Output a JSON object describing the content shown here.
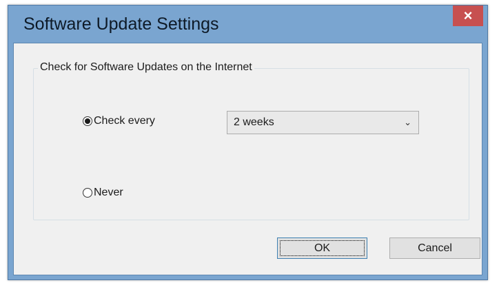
{
  "window": {
    "title": "Software Update Settings",
    "close_symbol": "×"
  },
  "group": {
    "legend": "Check for Software Updates on the Internet"
  },
  "options": {
    "check_every": {
      "label": "Check every",
      "selected": true
    },
    "never": {
      "label": "Never",
      "selected": false
    }
  },
  "frequency": {
    "value": "2 weeks",
    "chevron": "⌄"
  },
  "buttons": {
    "ok": "OK",
    "cancel": "Cancel"
  },
  "colors": {
    "frame": "#7aa5d0",
    "close": "#c75050",
    "client": "#f0f0f0"
  }
}
